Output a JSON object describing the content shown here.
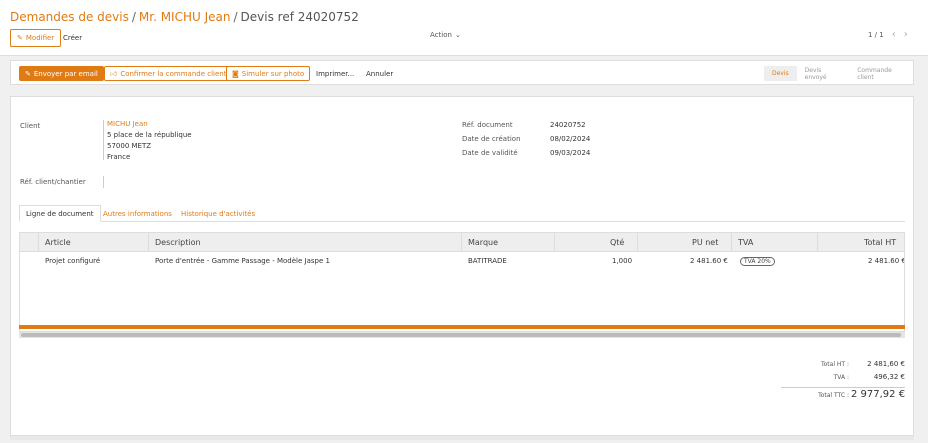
{
  "breadcrumb": {
    "items": [
      "Demandes de devis",
      "Mr. MICHU Jean"
    ],
    "current": "Devis ref 24020752",
    "separator": "/"
  },
  "toolbar": {
    "modify_label": "Modifier",
    "create_label": "Créer",
    "action_label": "Action",
    "pager": "1 / 1"
  },
  "actions": {
    "send_email": "Envoyer par email",
    "confirm_order": "Confirmer la commande client",
    "simulate_photo": "Simuler sur photo",
    "print": "Imprimer...",
    "cancel": "Annuler"
  },
  "status_steps": [
    {
      "label": "Devis",
      "active": true
    },
    {
      "label": "Devis envoyé",
      "active": false
    },
    {
      "label": "Commande client",
      "active": false
    }
  ],
  "client": {
    "label": "Client",
    "name": "MICHU Jean",
    "address_line1": "5 place de la république",
    "address_line2": "57000 METZ",
    "country": "France"
  },
  "client_ref": {
    "label": "Réf. client/chantier",
    "value": ""
  },
  "document": {
    "ref_label": "Réf. document",
    "ref_value": "24020752",
    "created_label": "Date de création",
    "created_value": "08/02/2024",
    "validity_label": "Date de validité",
    "validity_value": "09/03/2024"
  },
  "tabs": [
    {
      "label": "Ligne de document",
      "active": true
    },
    {
      "label": "Autres informations",
      "active": false
    },
    {
      "label": "Historique d'activités",
      "active": false
    }
  ],
  "table": {
    "columns": [
      "Article",
      "Description",
      "Marque",
      "Qté",
      "PU net",
      "TVA",
      "Total HT"
    ],
    "rows": [
      {
        "article": "Projet configuré",
        "description": "Porte d'entrée - Gamme Passage - Modèle Jaspe 1",
        "marque": "BATITRADE",
        "qte": "1,000",
        "pu_net": "2 481.60 €",
        "tva": "TVA 20%",
        "total_ht": "2 481.60 €"
      }
    ]
  },
  "totals": {
    "ht_label": "Total HT :",
    "ht_value": "2 481,60 €",
    "tva_label": "TVA :",
    "tva_value": "496,32 €",
    "ttc_label": "Total TTC :",
    "ttc_value": "2 977,92 €"
  },
  "colors": {
    "accent": "#e07b14"
  }
}
